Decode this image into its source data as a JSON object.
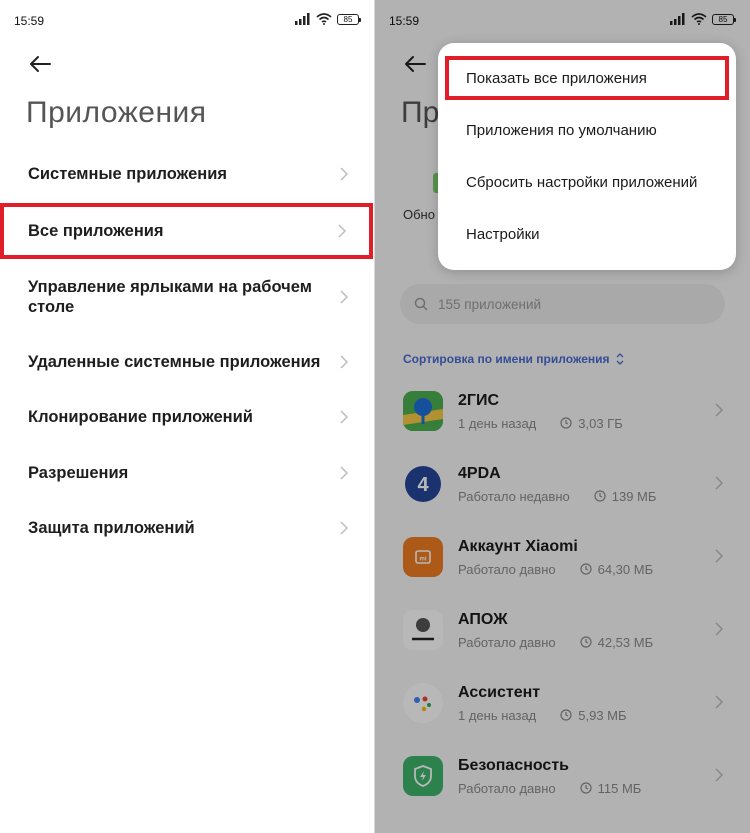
{
  "status": {
    "time": "15:59",
    "battery": "85"
  },
  "left": {
    "title": "Приложения",
    "items": [
      {
        "label": "Системные приложения"
      },
      {
        "label": "Все приложения"
      },
      {
        "label": "Управление ярлыками на рабочем столе"
      },
      {
        "label": "Удаленные системные приложения"
      },
      {
        "label": "Клонирование приложений"
      },
      {
        "label": "Разрешения"
      },
      {
        "label": "Защита приложений"
      }
    ]
  },
  "right": {
    "title_partial": "Пр",
    "tab_partial": "Обно",
    "popup": {
      "items": [
        {
          "label": "Показать все приложения"
        },
        {
          "label": "Приложения по умолчанию"
        },
        {
          "label": "Сбросить настройки приложений"
        },
        {
          "label": "Настройки"
        }
      ]
    },
    "search_placeholder": "155 приложений",
    "sort_label": "Сортировка по имени приложения",
    "apps": [
      {
        "name": "2ГИС",
        "status": "1 день назад",
        "size": "3,03 ГБ",
        "icon": "2gis-icon",
        "color": "#3aa54a"
      },
      {
        "name": "4PDA",
        "status": "Работало недавно",
        "size": "139 МБ",
        "icon": "4pda-icon",
        "color": "#2a4fa0"
      },
      {
        "name": "Аккаунт Xiaomi",
        "status": "Работало давно",
        "size": "64,30 МБ",
        "icon": "xiaomi-account-icon",
        "color": "#f07d22"
      },
      {
        "name": "АПОЖ",
        "status": "Работало давно",
        "size": "42,53 МБ",
        "icon": "apozh-icon",
        "color": "#ffffff"
      },
      {
        "name": "Ассистент",
        "status": "1 день назад",
        "size": "5,93 МБ",
        "icon": "assistant-icon",
        "color": "#ffffff"
      },
      {
        "name": "Безопасность",
        "status": "Работало давно",
        "size": "115 МБ",
        "icon": "security-icon",
        "color": "#3db36a"
      }
    ]
  },
  "colors": {
    "highlight": "#e01e2a",
    "accent": "#4a6ad1"
  }
}
